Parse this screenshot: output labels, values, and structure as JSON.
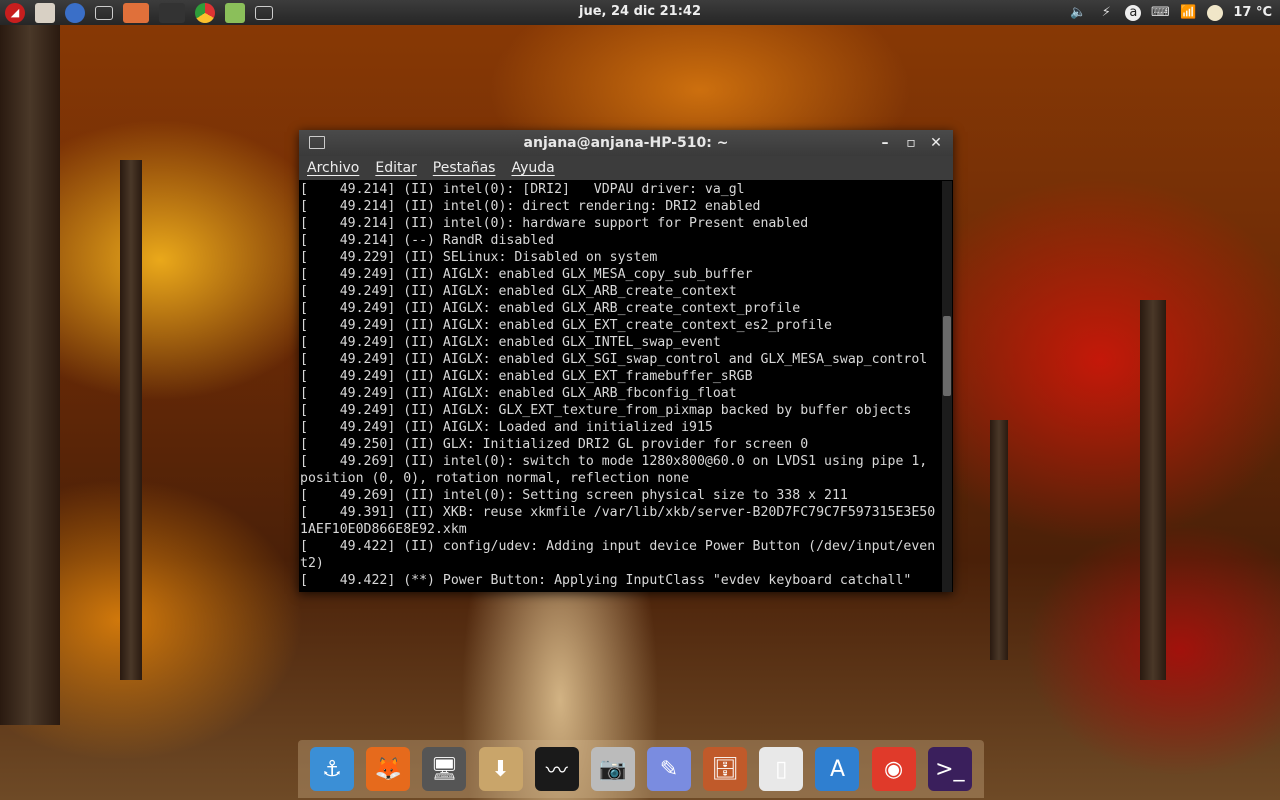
{
  "top_panel": {
    "clock": "jue, 24 dic 21:42",
    "weather": "17 °C"
  },
  "terminal": {
    "title": "anjana@anjana-HP-510: ~",
    "menu": [
      "Archivo",
      "Editar",
      "Pestañas",
      "Ayuda"
    ],
    "lines": [
      "[    49.214] (II) intel(0): [DRI2]   VDPAU driver: va_gl",
      "[    49.214] (II) intel(0): direct rendering: DRI2 enabled",
      "[    49.214] (II) intel(0): hardware support for Present enabled",
      "[    49.214] (--) RandR disabled",
      "[    49.229] (II) SELinux: Disabled on system",
      "[    49.249] (II) AIGLX: enabled GLX_MESA_copy_sub_buffer",
      "[    49.249] (II) AIGLX: enabled GLX_ARB_create_context",
      "[    49.249] (II) AIGLX: enabled GLX_ARB_create_context_profile",
      "[    49.249] (II) AIGLX: enabled GLX_EXT_create_context_es2_profile",
      "[    49.249] (II) AIGLX: enabled GLX_INTEL_swap_event",
      "[    49.249] (II) AIGLX: enabled GLX_SGI_swap_control and GLX_MESA_swap_control",
      "[    49.249] (II) AIGLX: enabled GLX_EXT_framebuffer_sRGB",
      "[    49.249] (II) AIGLX: enabled GLX_ARB_fbconfig_float",
      "[    49.249] (II) AIGLX: GLX_EXT_texture_from_pixmap backed by buffer objects",
      "[    49.249] (II) AIGLX: Loaded and initialized i915",
      "[    49.250] (II) GLX: Initialized DRI2 GL provider for screen 0",
      "[    49.269] (II) intel(0): switch to mode 1280x800@60.0 on LVDS1 using pipe 1,",
      "position (0, 0), rotation normal, reflection none",
      "[    49.269] (II) intel(0): Setting screen physical size to 338 x 211",
      "[    49.391] (II) XKB: reuse xkmfile /var/lib/xkb/server-B20D7FC79C7F597315E3E50",
      "1AEF10E0D866E8E92.xkm",
      "[    49.422] (II) config/udev: Adding input device Power Button (/dev/input/even",
      "t2)",
      "[    49.422] (**) Power Button: Applying InputClass \"evdev keyboard catchall\""
    ]
  },
  "dock": {
    "items": [
      {
        "name": "anchor-icon",
        "color": "#3b8fd6"
      },
      {
        "name": "firefox-icon",
        "color": "#e66a1c"
      },
      {
        "name": "monitor-icon",
        "color": "#555"
      },
      {
        "name": "download-folder-icon",
        "color": "#c9a56a"
      },
      {
        "name": "system-monitor-icon",
        "color": "#1a1a1a"
      },
      {
        "name": "camera-icon",
        "color": "#bbb"
      },
      {
        "name": "paint-icon",
        "color": "#7a8ce0"
      },
      {
        "name": "archive-icon",
        "color": "#c05a2a"
      },
      {
        "name": "document-icon",
        "color": "#e8e8e8"
      },
      {
        "name": "app-store-icon",
        "color": "#2f7fd0"
      },
      {
        "name": "chrome-icon",
        "color": "#e03a2a"
      },
      {
        "name": "terminal-icon",
        "color": "#3a1f5c"
      }
    ]
  }
}
